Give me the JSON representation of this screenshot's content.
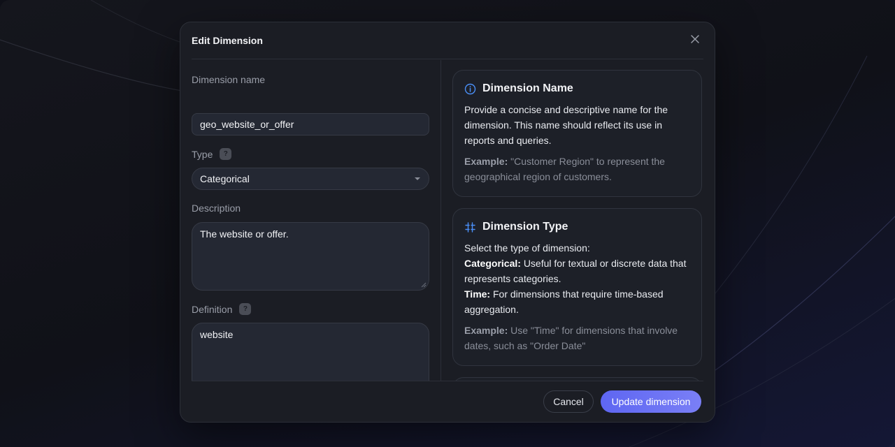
{
  "modal": {
    "title": "Edit Dimension",
    "close_icon": "close-icon"
  },
  "form": {
    "name_label": "Dimension name",
    "name_value": "geo_website_or_offer",
    "type_label": "Type",
    "type_help": "?",
    "type_value": "Categorical",
    "description_label": "Description",
    "description_value": "The website or offer.",
    "definition_label": "Definition",
    "definition_help": "?",
    "definition_value": "website"
  },
  "help": {
    "name_card": {
      "icon": "info-icon",
      "title": "Dimension Name",
      "body": "Provide a concise and descriptive name for the dimension. This name should reflect its use in reports and queries.",
      "example_label": "Example:",
      "example_text": "\"Customer Region\" to represent the geographical region of customers."
    },
    "type_card": {
      "icon": "dimension-type-icon",
      "title": "Dimension Type",
      "intro": "Select the type of dimension:",
      "categorical_label": "Categorical:",
      "categorical_text": "Useful for textual or discrete data that represents categories.",
      "time_label": "Time:",
      "time_text": "For dimensions that require time-based aggregation.",
      "example_label": "Example:",
      "example_text": "Use \"Time\" for dimensions that involve dates, such as \"Order Date\""
    }
  },
  "footer": {
    "cancel_label": "Cancel",
    "submit_label": "Update dimension"
  },
  "colors": {
    "accent": "#5e66f2",
    "info_icon": "#4a8ff7",
    "background": "#12141f",
    "modal": "#1b1d24"
  }
}
